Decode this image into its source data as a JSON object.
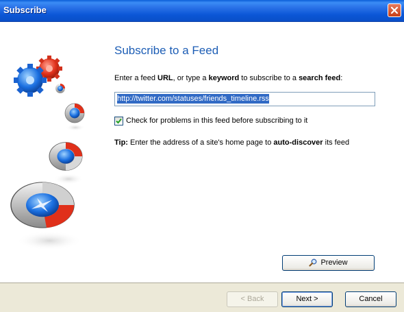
{
  "window": {
    "title": "Subscribe"
  },
  "header": {
    "heading": "Subscribe to a Feed"
  },
  "instruction": {
    "part1": "Enter a feed ",
    "url_bold": "URL",
    "part2": ", or type a ",
    "keyword_bold": "keyword",
    "part3": " to subscribe to a ",
    "search_feed_bold": "search feed",
    "part4": ":"
  },
  "feed_input": {
    "value": "http://twitter.com/statuses/friends_timeline.rss"
  },
  "check_problems": {
    "label": "Check for problems in this feed before subscribing to it",
    "checked": true
  },
  "tip": {
    "prefix_bold": "Tip:",
    "text": " Enter the address of a site's home page to ",
    "auto_bold": "auto-discover",
    "suffix": " its feed"
  },
  "buttons": {
    "preview": "Preview",
    "back": "< Back",
    "next": "Next >",
    "cancel": "Cancel"
  },
  "icons": {
    "close": "close-icon",
    "preview": "magnifier-icon",
    "decor": "gears-icon",
    "check": "checkmark-icon"
  },
  "colors": {
    "titlebar": "#0b56d6",
    "heading": "#1c5db5",
    "selection": "#316ac5"
  }
}
